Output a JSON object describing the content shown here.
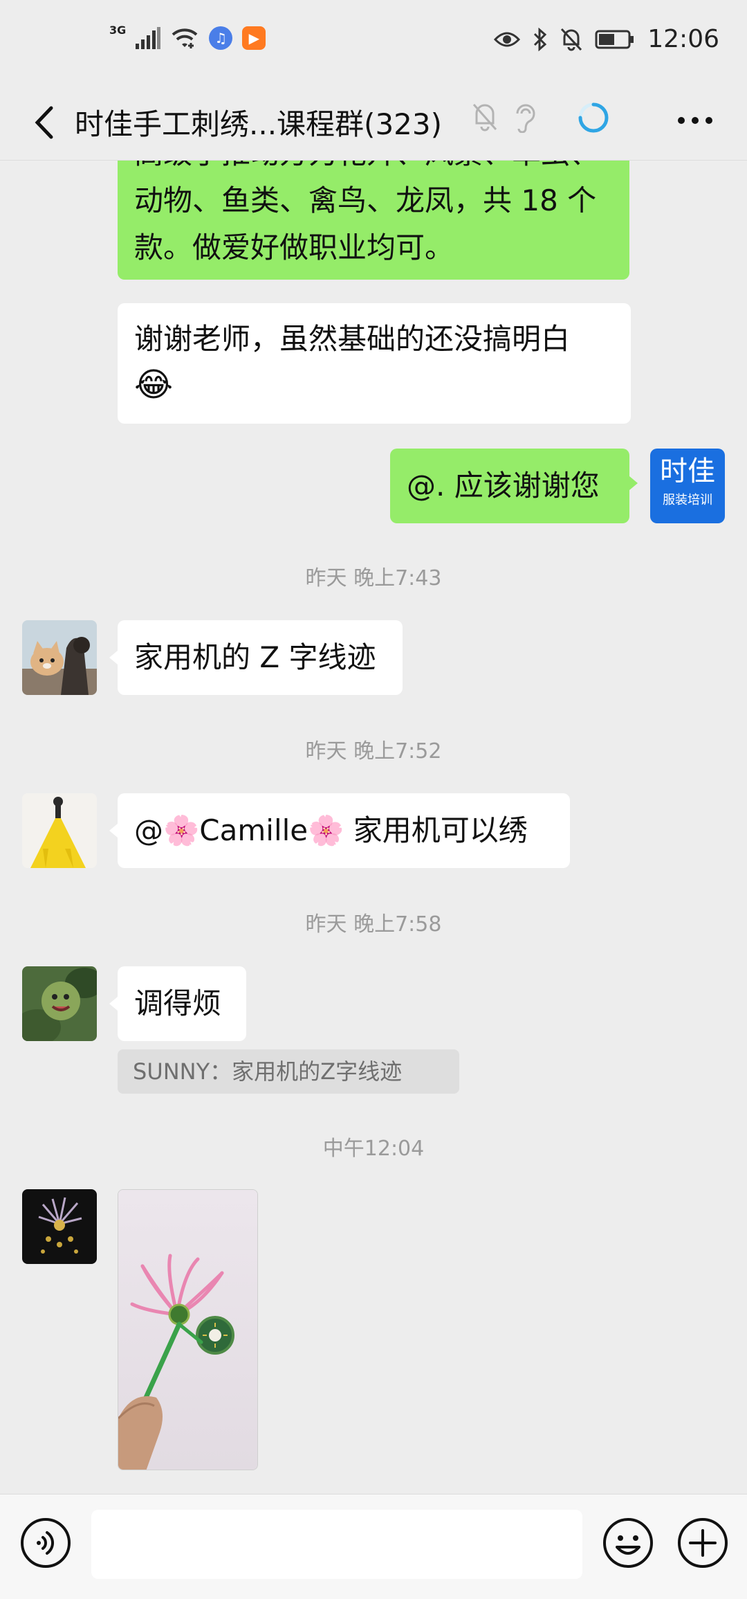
{
  "status_bar": {
    "network": "3G",
    "time": "12:06"
  },
  "header": {
    "title": "时佳手工刺绣...课程群(323)"
  },
  "messages": {
    "m1": {
      "line1": "高级手推动方力花卉、风景、草虫、",
      "line2": "动物、鱼类、禽鸟、龙凤，共 18 个",
      "line3": "款。做爱好做职业均可。"
    },
    "m2": {
      "line1": "谢谢老师，虽然基础的还没搞明白",
      "emoji": "😂"
    },
    "m3": {
      "text": "@. 应该谢谢您",
      "avatar_line1": "时佳",
      "avatar_line2": "服装培训"
    },
    "ts1": "昨天 晚上7:43",
    "m4": {
      "text": "家用机的 Z 字线迹"
    },
    "ts2": "昨天 晚上7:52",
    "m5": {
      "prefix": "@",
      "emoji": "🌸",
      "name": "Camille",
      "text": " 家用机可以绣"
    },
    "ts3": "昨天 晚上7:58",
    "m6": {
      "text": "调得烦",
      "quote": "SUNNY：家用机的Z字线迹"
    },
    "ts4": "中午12:04"
  },
  "colors": {
    "background": "#ededed",
    "green_bubble": "#95ec69",
    "white_bubble": "#ffffff",
    "timestamp": "#9a9a9a",
    "loading_accent": "#2fa5e4",
    "avatar_blue": "#1a6fe0"
  },
  "icons": {
    "back": "chevron-left-icon",
    "mute": "bell-off-icon",
    "ear": "ear-icon",
    "loading": "loading-ring-icon",
    "more": "more-dots-icon",
    "voice": "voice-icon",
    "emoji": "smiley-icon",
    "plus": "plus-icon"
  }
}
